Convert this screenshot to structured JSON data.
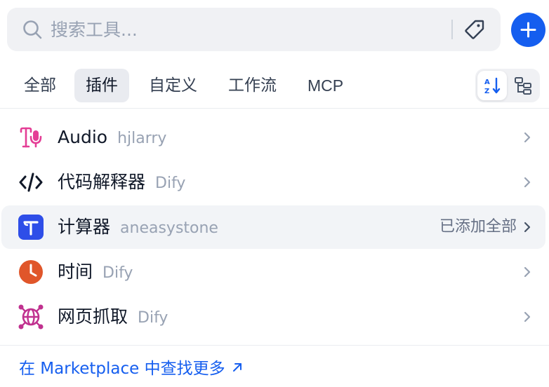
{
  "search": {
    "placeholder": "搜索工具...",
    "value": ""
  },
  "tabs": [
    {
      "label": "全部",
      "active": false
    },
    {
      "label": "插件",
      "active": true
    },
    {
      "label": "自定义",
      "active": false
    },
    {
      "label": "工作流",
      "active": false
    },
    {
      "label": "MCP",
      "active": false
    }
  ],
  "tools": [
    {
      "name": "Audio",
      "author": "hjlarry",
      "icon": "audio-icon",
      "status": ""
    },
    {
      "name": "代码解释器",
      "author": "Dify",
      "icon": "code-icon",
      "status": ""
    },
    {
      "name": "计算器",
      "author": "aneasystone",
      "icon": "calculator-icon",
      "status": "已添加全部"
    },
    {
      "name": "时间",
      "author": "Dify",
      "icon": "clock-icon",
      "status": ""
    },
    {
      "name": "网页抓取",
      "author": "Dify",
      "icon": "web-scraper-icon",
      "status": ""
    }
  ],
  "marketplace": {
    "label": "在 Marketplace 中查找更多"
  },
  "colors": {
    "accent": "#155eef",
    "audio": "#e43d95",
    "calculator": "#2e4ee8",
    "clock": "#e0562a",
    "web": "#c0318f"
  }
}
